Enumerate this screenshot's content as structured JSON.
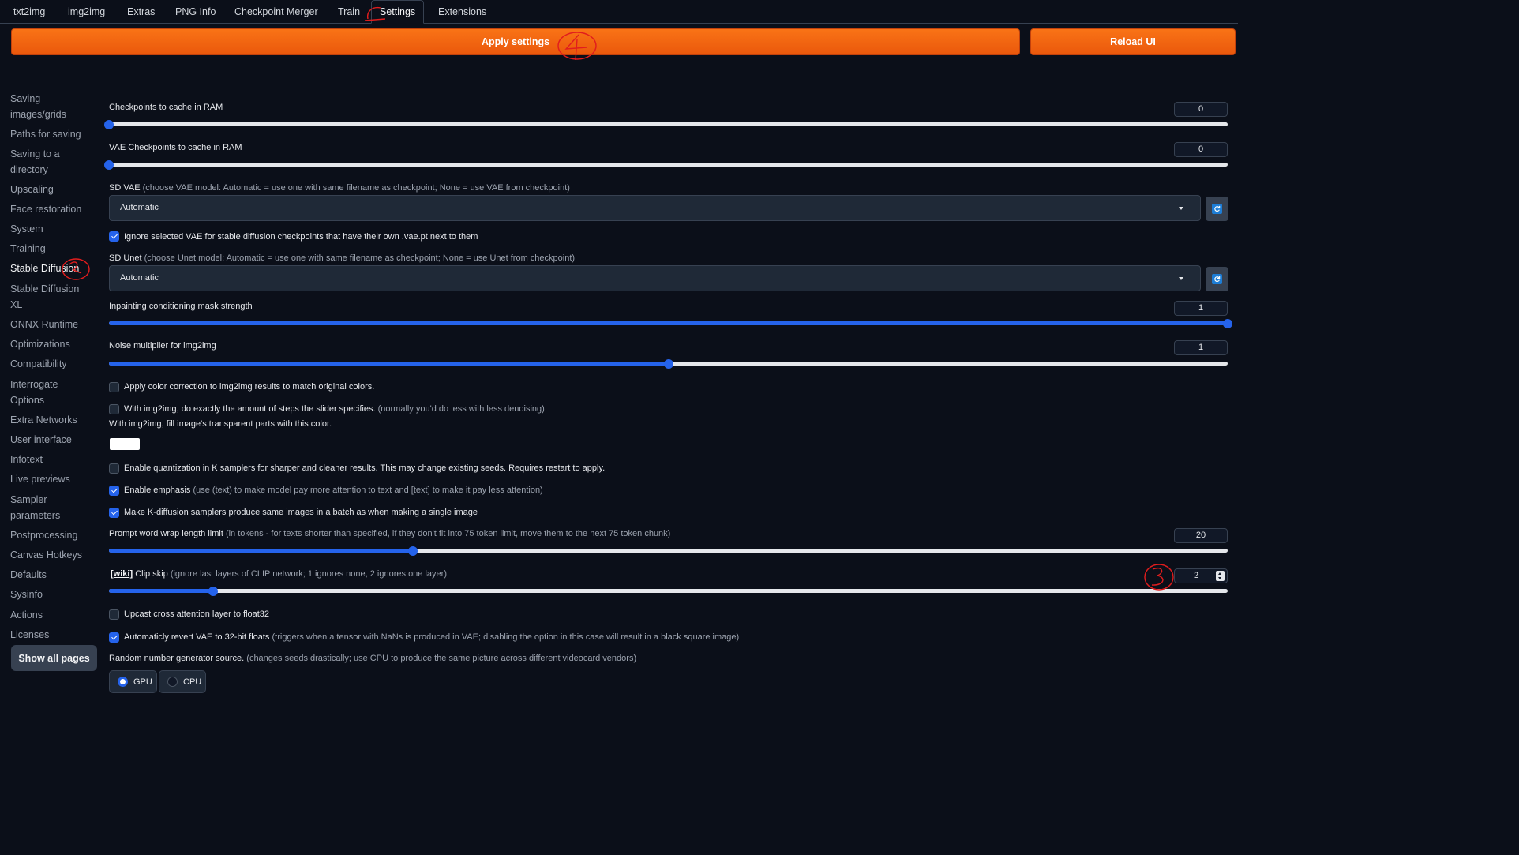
{
  "tabs": [
    "txt2img",
    "img2img",
    "Extras",
    "PNG Info",
    "Checkpoint Merger",
    "Train",
    "Settings",
    "Extensions"
  ],
  "buttons": {
    "apply": "Apply settings",
    "reload": "Reload UI",
    "show_all": "Show all pages"
  },
  "sidebar": [
    "Saving images/grids",
    "Paths for saving",
    "Saving to a directory",
    "Upscaling",
    "Face restoration",
    "System",
    "Training",
    "Stable Diffusion",
    "Stable Diffusion XL",
    "ONNX Runtime",
    "Optimizations",
    "Compatibility",
    "Interrogate Options",
    "Extra Networks",
    "User interface",
    "Infotext",
    "Live previews",
    "Sampler parameters",
    "Postprocessing",
    "Canvas Hotkeys",
    "Defaults",
    "Sysinfo",
    "Actions",
    "Licenses"
  ],
  "sidebar_active": "Stable Diffusion",
  "settings": {
    "ckpt_cache": {
      "label": "Checkpoints to cache in RAM",
      "value": "0",
      "fraction": 0.0
    },
    "vae_cache": {
      "label": "VAE Checkpoints to cache in RAM",
      "value": "0",
      "fraction": 0.0
    },
    "sd_vae": {
      "label": "SD VAE",
      "hint": "(choose VAE model: Automatic = use one with same filename as checkpoint; None = use VAE from checkpoint)",
      "value": "Automatic"
    },
    "ignore_vae": {
      "label": "Ignore selected VAE for stable diffusion checkpoints that have their own .vae.pt next to them",
      "checked": true
    },
    "sd_unet": {
      "label": "SD Unet",
      "hint": "(choose Unet model: Automatic = use one with same filename as checkpoint; None = use Unet from checkpoint)",
      "value": "Automatic"
    },
    "inpaint_mask": {
      "label": "Inpainting conditioning mask strength",
      "value": "1",
      "fraction": 1.0
    },
    "noise_mult": {
      "label": "Noise multiplier for img2img",
      "value": "1",
      "fraction": 0.5
    },
    "color_correction": {
      "label": "Apply color correction to img2img results to match original colors.",
      "checked": false
    },
    "exact_steps": {
      "label": "With img2img, do exactly the amount of steps the slider specifies.",
      "hint": "(normally you'd do less with less denoising)",
      "checked": false
    },
    "fill_color": {
      "label": "With img2img, fill image's transparent parts with this color.",
      "color": "#ffffff"
    },
    "quantization": {
      "label": "Enable quantization in K samplers for sharper and cleaner results. This may change existing seeds. Requires restart to apply.",
      "checked": false
    },
    "emphasis": {
      "label": "Enable emphasis",
      "hint": "(use (text) to make model pay more attention to text and [text] to make it pay less attention)",
      "checked": true
    },
    "batch_same": {
      "label": "Make K-diffusion samplers produce same images in a batch as when making a single image",
      "checked": true
    },
    "wrap_length": {
      "label": "Prompt word wrap length limit",
      "hint": "(in tokens - for texts shorter than specified, if they don't fit into 75 token limit, move them to the next 75 token chunk)",
      "value": "20",
      "fraction": 0.272
    },
    "clip_skip": {
      "wiki": "[wiki]",
      "label": "Clip skip",
      "hint": "(ignore last layers of CLIP network; 1 ignores none, 2 ignores one layer)",
      "value": "2",
      "fraction": 0.0935
    },
    "upcast": {
      "label": "Upcast cross attention layer to float32",
      "checked": false
    },
    "revert_vae": {
      "label": "Automaticly revert VAE to 32-bit floats",
      "hint": "(triggers when a tensor with NaNs is produced in VAE; disabling the option in this case will result in a black square image)",
      "checked": true
    },
    "rng": {
      "label": "Random number generator source.",
      "hint": "(changes seeds drastically; use CPU to produce the same picture across different videocard vendors)",
      "options": [
        "GPU",
        "CPU"
      ],
      "selected": "GPU"
    }
  },
  "colors": {
    "accent": "#2563eb",
    "orange": "#f97316",
    "annotation": "#e11d1d"
  },
  "annotations": [
    "2",
    "4",
    "3"
  ]
}
